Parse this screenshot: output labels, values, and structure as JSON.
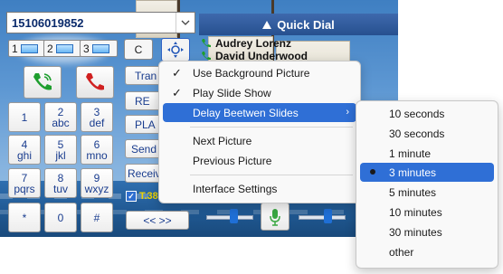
{
  "phone": {
    "number_value": "15106019852",
    "quick_dial": {
      "title": "Quick Dial",
      "contacts": [
        "Audrey Lorenz",
        "David Underwood"
      ]
    },
    "lines": [
      "1",
      "2",
      "3"
    ],
    "clear_label": "C",
    "keypad": [
      {
        "digit": "1",
        "letters": ""
      },
      {
        "digit": "2",
        "letters": "abc"
      },
      {
        "digit": "3",
        "letters": "def"
      },
      {
        "digit": "4",
        "letters": "ghi"
      },
      {
        "digit": "5",
        "letters": "jkl"
      },
      {
        "digit": "6",
        "letters": "mno"
      },
      {
        "digit": "7",
        "letters": "pqrs"
      },
      {
        "digit": "8",
        "letters": "tuv"
      },
      {
        "digit": "9",
        "letters": "wxyz"
      },
      {
        "digit": "*",
        "letters": ""
      },
      {
        "digit": "0",
        "letters": ""
      },
      {
        "digit": "#",
        "letters": ""
      }
    ],
    "side_buttons": [
      "Tran",
      "RE",
      "PLA",
      "Send",
      "Receiv"
    ],
    "t38_label": "T.38",
    "nav_label": "<< >>",
    "colors": {
      "call": "#1e9e2e",
      "hangup": "#d02020",
      "accent": "#2f6fd6"
    }
  },
  "context_menu": {
    "items": [
      {
        "label": "Use Background Picture",
        "checked": true
      },
      {
        "label": "Play Slide Show",
        "checked": true
      },
      {
        "label": "Delay Beetwen Slides",
        "submenu": true,
        "highlighted": true
      },
      {
        "label": "Next Picture"
      },
      {
        "label": "Previous Picture"
      },
      {
        "label": "Interface Settings"
      }
    ]
  },
  "delay_submenu": {
    "items": [
      "10 seconds",
      "30 seconds",
      "1 minute",
      "3 minutes",
      "5 minutes",
      "10 minutes",
      "30 minutes",
      "other"
    ],
    "selected": "3 minutes"
  }
}
